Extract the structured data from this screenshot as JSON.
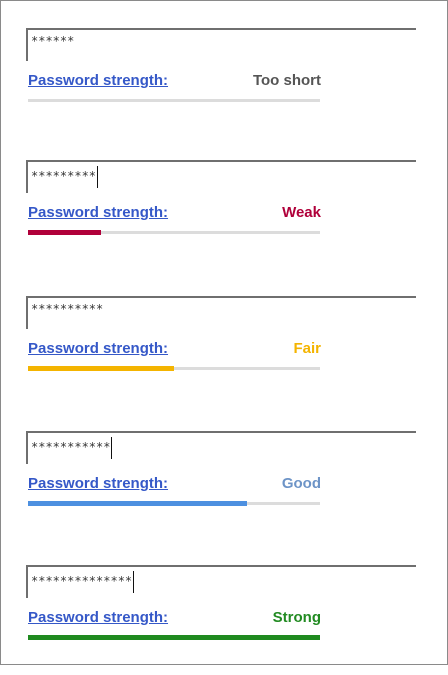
{
  "panels": [
    {
      "value": "******",
      "link_label": "Password strength:",
      "strength": "Too short",
      "strength_color": "#555555",
      "fill_fraction": 0.0,
      "meter_color": "#dcdcdc",
      "caret": false
    },
    {
      "value": "*********",
      "link_label": "Password strength:",
      "strength": "Weak",
      "strength_color": "#b0003a",
      "fill_fraction": 0.25,
      "meter_color": "#b0003a",
      "caret": true
    },
    {
      "value": "**********",
      "link_label": "Password strength:",
      "strength": "Fair",
      "strength_color": "#f4b400",
      "fill_fraction": 0.5,
      "meter_color": "#f4b400",
      "caret": false
    },
    {
      "value": "***********",
      "link_label": "Password strength:",
      "strength": "Good",
      "strength_color": "#6d94c7",
      "fill_fraction": 0.75,
      "meter_color": "#4d90e0",
      "caret": true
    },
    {
      "value": "**************",
      "link_label": "Password strength:",
      "strength": "Strong",
      "strength_color": "#228b22",
      "fill_fraction": 1.0,
      "meter_color": "#1f8a1f",
      "caret": true
    }
  ]
}
